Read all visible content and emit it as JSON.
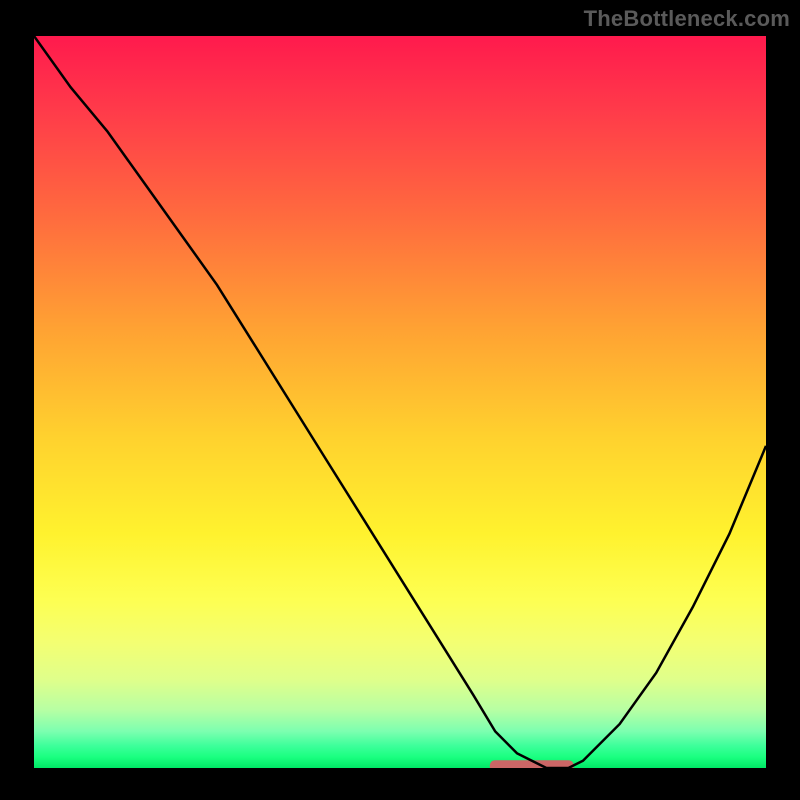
{
  "watermark": "TheBottleneck.com",
  "chart_data": {
    "type": "line",
    "title": "",
    "xlabel": "",
    "ylabel": "",
    "xlim": [
      0,
      100
    ],
    "ylim": [
      0,
      100
    ],
    "series": [
      {
        "name": "curve",
        "x": [
          0,
          5,
          10,
          15,
          20,
          25,
          30,
          35,
          40,
          45,
          50,
          55,
          60,
          63,
          66,
          70,
          73,
          75,
          80,
          85,
          90,
          95,
          100
        ],
        "y": [
          100,
          93,
          87,
          80,
          73,
          66,
          58,
          50,
          42,
          34,
          26,
          18,
          10,
          5,
          2,
          0,
          0,
          1,
          6,
          13,
          22,
          32,
          44
        ]
      }
    ],
    "highlight": {
      "x_start": 63,
      "x_end": 73,
      "y": 0.3
    },
    "gradient_stops": [
      {
        "pos": 0.0,
        "color": "#ff1a4d"
      },
      {
        "pos": 0.1,
        "color": "#ff3a4a"
      },
      {
        "pos": 0.25,
        "color": "#ff6c3e"
      },
      {
        "pos": 0.4,
        "color": "#ffa233"
      },
      {
        "pos": 0.55,
        "color": "#ffd22e"
      },
      {
        "pos": 0.68,
        "color": "#fff22e"
      },
      {
        "pos": 0.77,
        "color": "#fdff52"
      },
      {
        "pos": 0.83,
        "color": "#f3ff73"
      },
      {
        "pos": 0.88,
        "color": "#dfff8b"
      },
      {
        "pos": 0.92,
        "color": "#b8ffa3"
      },
      {
        "pos": 0.95,
        "color": "#7cffb0"
      },
      {
        "pos": 0.97,
        "color": "#3cff9a"
      },
      {
        "pos": 0.985,
        "color": "#1aff80"
      },
      {
        "pos": 1.0,
        "color": "#00e866"
      }
    ]
  }
}
